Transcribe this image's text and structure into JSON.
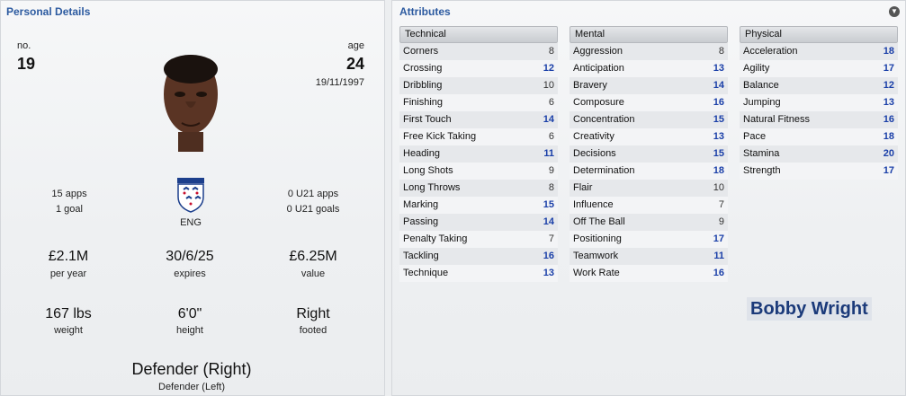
{
  "personal": {
    "title": "Personal Details",
    "no_label": "no.",
    "no_value": "19",
    "age_label": "age",
    "age_value": "24",
    "dob": "19/11/1997",
    "apps": "15 apps",
    "goals": "1 goal",
    "nation": "ENG",
    "u21_apps": "0 U21 apps",
    "u21_goals": "0 U21 goals",
    "wage": "£2.1M",
    "wage_label": "per year",
    "expires": "30/6/25",
    "expires_label": "expires",
    "value": "£6.25M",
    "value_label": "value",
    "weight": "167 lbs",
    "weight_label": "weight",
    "height": "6'0\"",
    "height_label": "height",
    "foot": "Right",
    "foot_label": "footed",
    "position": "Defender (Right)",
    "alt_position": "Defender (Left)"
  },
  "attributes": {
    "title": "Attributes",
    "technical": {
      "header": "Technical",
      "rows": [
        {
          "name": "Corners",
          "value": "8"
        },
        {
          "name": "Crossing",
          "value": "12"
        },
        {
          "name": "Dribbling",
          "value": "10"
        },
        {
          "name": "Finishing",
          "value": "6"
        },
        {
          "name": "First Touch",
          "value": "14"
        },
        {
          "name": "Free Kick Taking",
          "value": "6"
        },
        {
          "name": "Heading",
          "value": "11"
        },
        {
          "name": "Long Shots",
          "value": "9"
        },
        {
          "name": "Long Throws",
          "value": "8"
        },
        {
          "name": "Marking",
          "value": "15"
        },
        {
          "name": "Passing",
          "value": "14"
        },
        {
          "name": "Penalty Taking",
          "value": "7"
        },
        {
          "name": "Tackling",
          "value": "16"
        },
        {
          "name": "Technique",
          "value": "13"
        }
      ]
    },
    "mental": {
      "header": "Mental",
      "rows": [
        {
          "name": "Aggression",
          "value": "8"
        },
        {
          "name": "Anticipation",
          "value": "13"
        },
        {
          "name": "Bravery",
          "value": "14"
        },
        {
          "name": "Composure",
          "value": "16"
        },
        {
          "name": "Concentration",
          "value": "15"
        },
        {
          "name": "Creativity",
          "value": "13"
        },
        {
          "name": "Decisions",
          "value": "15"
        },
        {
          "name": "Determination",
          "value": "18"
        },
        {
          "name": "Flair",
          "value": "10"
        },
        {
          "name": "Influence",
          "value": "7"
        },
        {
          "name": "Off The Ball",
          "value": "9"
        },
        {
          "name": "Positioning",
          "value": "17"
        },
        {
          "name": "Teamwork",
          "value": "11"
        },
        {
          "name": "Work Rate",
          "value": "16"
        }
      ]
    },
    "physical": {
      "header": "Physical",
      "rows": [
        {
          "name": "Acceleration",
          "value": "18"
        },
        {
          "name": "Agility",
          "value": "17"
        },
        {
          "name": "Balance",
          "value": "12"
        },
        {
          "name": "Jumping",
          "value": "13"
        },
        {
          "name": "Natural Fitness",
          "value": "16"
        },
        {
          "name": "Pace",
          "value": "18"
        },
        {
          "name": "Stamina",
          "value": "20"
        },
        {
          "name": "Strength",
          "value": "17"
        }
      ]
    }
  },
  "player_name": "Bobby Wright",
  "colors": {
    "title_blue": "#2c5aa0",
    "high_value_blue": "#1a3fa8",
    "normal_value": "#333333"
  },
  "icons": {
    "collapse": "chevron-down-icon",
    "nation_crest": "england-crest-icon",
    "portrait": "player-portrait"
  }
}
